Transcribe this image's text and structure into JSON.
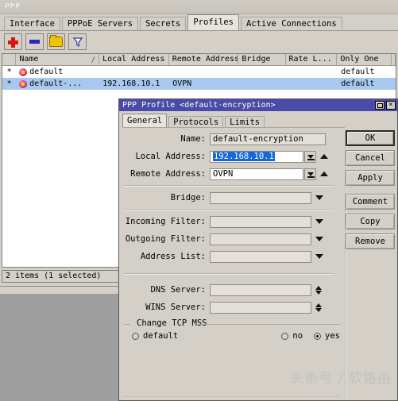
{
  "window": {
    "title": "PPP",
    "tabs": [
      {
        "label": "Interface",
        "active": false
      },
      {
        "label": "PPPoE Servers",
        "active": false
      },
      {
        "label": "Secrets",
        "active": false
      },
      {
        "label": "Profiles",
        "active": true
      },
      {
        "label": "Active Connections",
        "active": false
      }
    ],
    "toolbar": [
      {
        "name": "add-button",
        "icon": "plus-icon"
      },
      {
        "name": "remove-button",
        "icon": "minus-icon"
      },
      {
        "name": "enable-button",
        "icon": "folder-icon"
      },
      {
        "name": "filter-button",
        "icon": "funnel-icon"
      }
    ],
    "status": "2 items (1 selected)"
  },
  "table": {
    "columns": [
      "",
      "Name",
      "Local Address",
      "Remote Address",
      "Bridge",
      "Rate L...",
      "Only One"
    ],
    "sort_column": "Name",
    "rows": [
      {
        "flag": "*",
        "name": "default",
        "local_address": "",
        "remote_address": "",
        "bridge": "",
        "rate_limit": "",
        "only_one": "default",
        "selected": false
      },
      {
        "flag": "*",
        "name": "default-...",
        "local_address": "192.168.10.1",
        "remote_address": "OVPN",
        "bridge": "",
        "rate_limit": "",
        "only_one": "default",
        "selected": true
      }
    ]
  },
  "dialog": {
    "title": "PPP Profile <default-encryption>",
    "window_buttons": {
      "maximize": "maximize-icon",
      "close": "×"
    },
    "tabs": [
      {
        "label": "General",
        "active": true
      },
      {
        "label": "Protocols",
        "active": false
      },
      {
        "label": "Limits",
        "active": false
      }
    ],
    "fields": {
      "name": {
        "label": "Name:",
        "value": "default-encryption"
      },
      "local_address": {
        "label": "Local Address:",
        "value": "192.168.10.1",
        "selected": true
      },
      "remote_address": {
        "label": "Remote Address:",
        "value": "OVPN"
      },
      "bridge": {
        "label": "Bridge:",
        "value": ""
      },
      "incoming_filter": {
        "label": "Incoming Filter:",
        "value": ""
      },
      "outgoing_filter": {
        "label": "Outgoing Filter:",
        "value": ""
      },
      "address_list": {
        "label": "Address List:",
        "value": ""
      },
      "dns_server": {
        "label": "DNS Server:",
        "value": ""
      },
      "wins_server": {
        "label": "WINS Server:",
        "value": ""
      }
    },
    "mss": {
      "legend": "Change TCP MSS",
      "options": [
        {
          "label": "default",
          "selected": false
        },
        {
          "label": "no",
          "selected": false
        },
        {
          "label": "yes",
          "selected": true
        }
      ]
    },
    "buttons": [
      {
        "label": "OK",
        "primary": true
      },
      {
        "label": "Cancel",
        "primary": false
      },
      {
        "label": "Apply",
        "primary": false
      },
      {
        "label": "Comment",
        "primary": false
      },
      {
        "label": "Copy",
        "primary": false
      },
      {
        "label": "Remove",
        "primary": false
      }
    ]
  },
  "watermark": "头条号 / 软路由",
  "colors": {
    "face": "#d4d0c8",
    "desktop": "#9e9e9e",
    "dialog_title": "#4a4aa8",
    "selection": "#a8c8f0",
    "text_selection": "#1668d8",
    "accent_red": "#d81616",
    "accent_blue": "#2a2ab4",
    "accent_yellow": "#f2c400"
  }
}
